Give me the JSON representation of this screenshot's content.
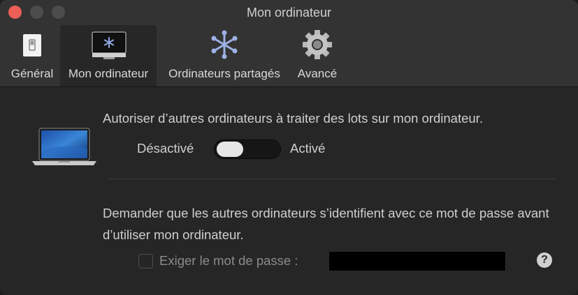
{
  "window": {
    "title": "Mon ordinateur"
  },
  "toolbar": {
    "items": [
      {
        "label": "Général",
        "icon": "general-switch-icon"
      },
      {
        "label": "Mon ordinateur",
        "icon": "monitor-icon",
        "selected": true
      },
      {
        "label": "Ordinateurs partagés",
        "icon": "shared-computers-icon"
      },
      {
        "label": "Avancé",
        "icon": "gear-icon"
      }
    ]
  },
  "main": {
    "allow_text": "Autoriser d’autres ordinateurs à traiter des lots sur mon ordinateur.",
    "toggle": {
      "off_label": "Désactivé",
      "on_label": "Activé",
      "state": "off"
    },
    "password_desc": "Demander que les autres ordinateurs s’identifient avec ce mot de passe avant d’utiliser mon ordinateur.",
    "password_checkbox_label": "Exiger le mot de passe :",
    "password_checked": false,
    "password_value": "",
    "help_symbol": "?"
  },
  "colors": {
    "close": "#ec5f57",
    "accent_icon": "#8fa8e0"
  }
}
